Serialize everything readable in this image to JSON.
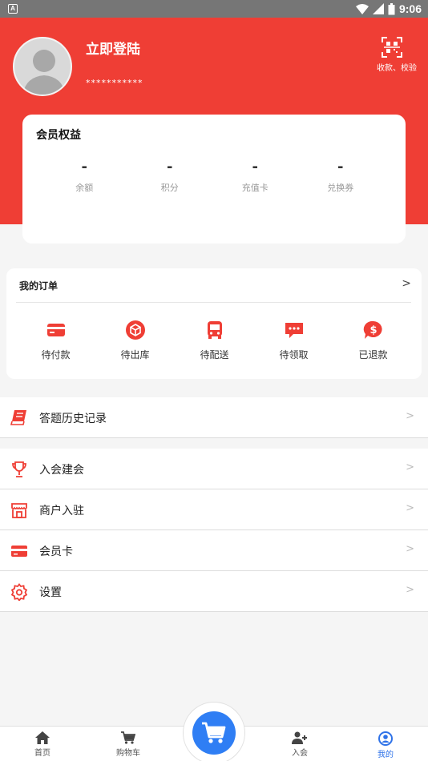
{
  "status_bar": {
    "time": "9:06",
    "notif_letter": "A"
  },
  "profile": {
    "login_label": "立即登陆",
    "phone_masked": "***********",
    "scan_label": "收款、校验"
  },
  "member": {
    "title": "会员权益",
    "stats": [
      {
        "value": "-",
        "label": "余额"
      },
      {
        "value": "-",
        "label": "积分"
      },
      {
        "value": "-",
        "label": "充值卡"
      },
      {
        "value": "-",
        "label": "兑换券"
      }
    ]
  },
  "orders": {
    "title": "我的订单",
    "arrow": ">",
    "items": [
      {
        "label": "待付款",
        "icon": "card-icon"
      },
      {
        "label": "待出库",
        "icon": "box-icon"
      },
      {
        "label": "待配送",
        "icon": "bus-icon"
      },
      {
        "label": "待领取",
        "icon": "chat-icon"
      },
      {
        "label": "已退款",
        "icon": "dollar-bubble-icon"
      }
    ]
  },
  "menu": {
    "history": "答题历史记录",
    "join": "入会建会",
    "merchant": "商户入驻",
    "card": "会员卡",
    "settings": "设置",
    "arrow": ">"
  },
  "tabs": {
    "home": "首页",
    "cart": "购物车",
    "join": "入会",
    "mine": "我的"
  },
  "colors": {
    "brand_red": "#ef3e35",
    "accent_blue": "#2f7ef4"
  }
}
